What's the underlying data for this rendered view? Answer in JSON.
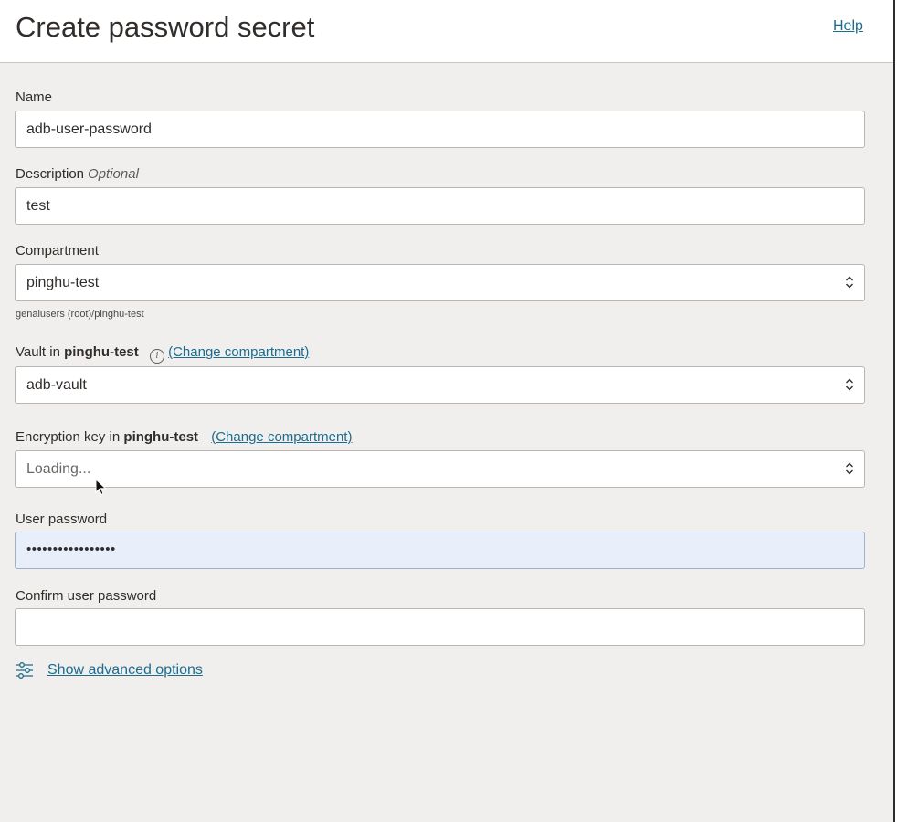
{
  "header": {
    "title": "Create password secret",
    "help_label": "Help"
  },
  "form": {
    "name": {
      "label": "Name",
      "value": "adb-user-password"
    },
    "description": {
      "label": "Description",
      "optional": "Optional",
      "value": "test"
    },
    "compartment": {
      "label": "Compartment",
      "value": "pinghu-test",
      "hint": "genaiusers (root)/pinghu-test"
    },
    "vault": {
      "label_prefix": "Vault in",
      "label_compartment": "pinghu-test",
      "change_link": "(Change compartment)",
      "value": "adb-vault"
    },
    "encryption_key": {
      "label_prefix": "Encryption key in",
      "label_compartment": "pinghu-test",
      "change_link": "(Change compartment)",
      "value": "Loading..."
    },
    "user_password": {
      "label": "User password",
      "value": "•••••••••••••••••"
    },
    "confirm_password": {
      "label": "Confirm user password",
      "value": ""
    },
    "advanced_link": "Show advanced options"
  },
  "colors": {
    "link": "#1b6c8f",
    "panel_bg": "#f1efed",
    "focused_field_bg": "#e8effa"
  },
  "icons": {
    "info": "info-icon",
    "select": "chevron-updown-icon",
    "advanced": "sliders-icon",
    "cursor": "mouse-pointer-icon"
  }
}
